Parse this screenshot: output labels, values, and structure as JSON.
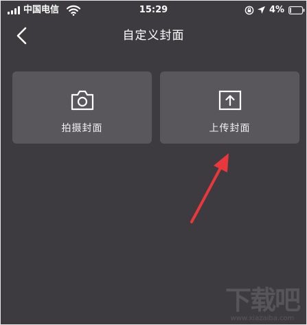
{
  "status_bar": {
    "carrier": "中国电信",
    "time": "15:29",
    "battery_percent": "4%",
    "icons": [
      "signal-icon",
      "wifi-icon",
      "rotation-lock-icon",
      "location-icon",
      "battery-icon"
    ]
  },
  "nav": {
    "title": "自定义封面",
    "back_icon": "chevron-left-icon"
  },
  "cards": [
    {
      "label": "拍摄封面",
      "icon": "camera-icon"
    },
    {
      "label": "上传封面",
      "icon": "upload-icon"
    }
  ],
  "watermark": {
    "brand": "下载吧",
    "url": "www.xiazaiba.com"
  },
  "colors": {
    "background": "#3d3b3f",
    "card": "#59575b",
    "text": "#ffffff",
    "annotation": "#e8383d"
  }
}
